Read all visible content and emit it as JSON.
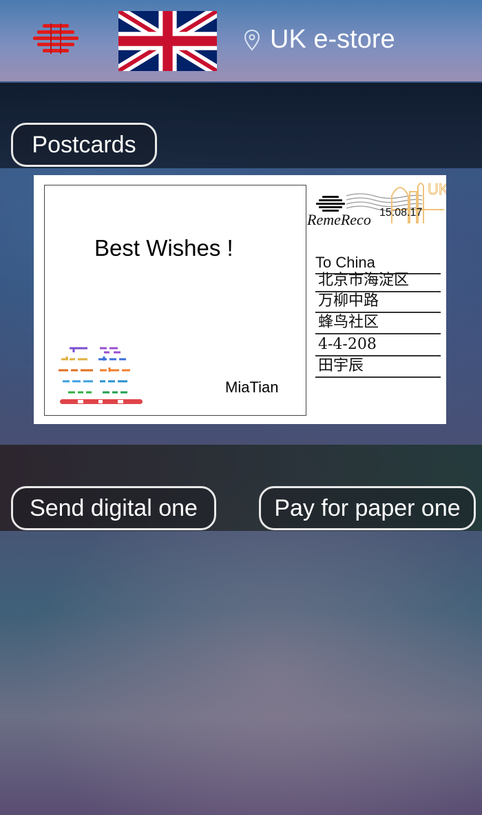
{
  "header": {
    "store_label": "UK e-store",
    "logo_icon": "remereco-logo-icon",
    "flag_icon": "uk-flag-icon",
    "location_icon": "location-pin-icon",
    "logo_color": "#e01b1b"
  },
  "section": {
    "postcards_label": "Postcards"
  },
  "postcard": {
    "greeting": "Best Wishes !",
    "signature": "MiaTian",
    "brand_name": "RemeReco",
    "postmark_date": "15.08.17",
    "postmark_text": "UK",
    "address": [
      "To China",
      "北京市海淀区",
      "万柳中路",
      "蜂鸟社区",
      "4-4-208",
      "田宇辰"
    ]
  },
  "actions": {
    "send_digital_label": "Send digital one",
    "pay_paper_label": "Pay for paper one"
  }
}
